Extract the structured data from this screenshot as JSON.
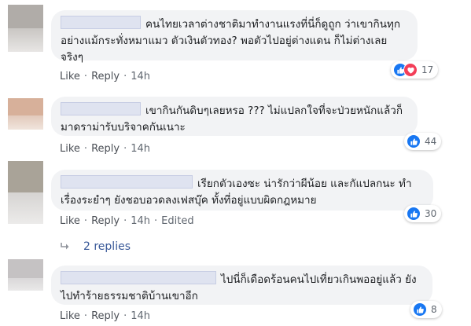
{
  "comments": [
    {
      "text": "คนไทยเวลาต่างชาติมาทำงานแรงที่นี่ก็ดูถูก ว่าเขากินทุกอย่างแม้กระทั่งหมาแมว ตัวเงินตัวทอง? พอตัวไปอยู่ต่างแดน ก็ไม่ต่างเลย จริงๆ",
      "like": "Like",
      "reply": "Reply",
      "time": "14h",
      "reaction_count": "17",
      "reactions": [
        "like-icon",
        "love-icon"
      ]
    },
    {
      "text": "เขากินกันดิบๆเลยหรอ ??? ไม่แปลกใจที่จะป่วยหนักแล้วก็มาดราม่ารับบริจาคกันเนาะ",
      "like": "Like",
      "reply": "Reply",
      "time": "14h",
      "reaction_count": "44",
      "reactions": [
        "like-icon"
      ]
    },
    {
      "text": "เรียกตัวเองซะ น่ารักว่าผีน้อย และกัแปลกนะ ทำเรื่องระยำๆ ยังชอบอวดลงเฟสบุ๊ค ทั้งที่อยู่แบบผิดกฎหมาย",
      "like": "Like",
      "reply": "Reply",
      "time": "14h",
      "edited": "Edited",
      "reaction_count": "30",
      "reactions": [
        "like-icon"
      ],
      "replies_label": "2 replies"
    },
    {
      "text": "ไปนี่ก็เดือดร้อนคนไปเที่ยวเกินพออยู่แล้ว ยังไปทำร้ายธรรมชาติบ้านเขาอีก",
      "like": "Like",
      "reply": "Reply",
      "time": "14h",
      "reaction_count": "8",
      "reactions": [
        "like-icon"
      ]
    }
  ],
  "colors": {
    "avatar_1": "#b0aca8",
    "avatar_2": "#d7b09a",
    "avatar_3": "#a9a398",
    "avatar_4": "#c5c2c3",
    "like_blue": "#1877f2",
    "love_red": "#f33e58",
    "bubble_bg": "#f2f3f5"
  }
}
